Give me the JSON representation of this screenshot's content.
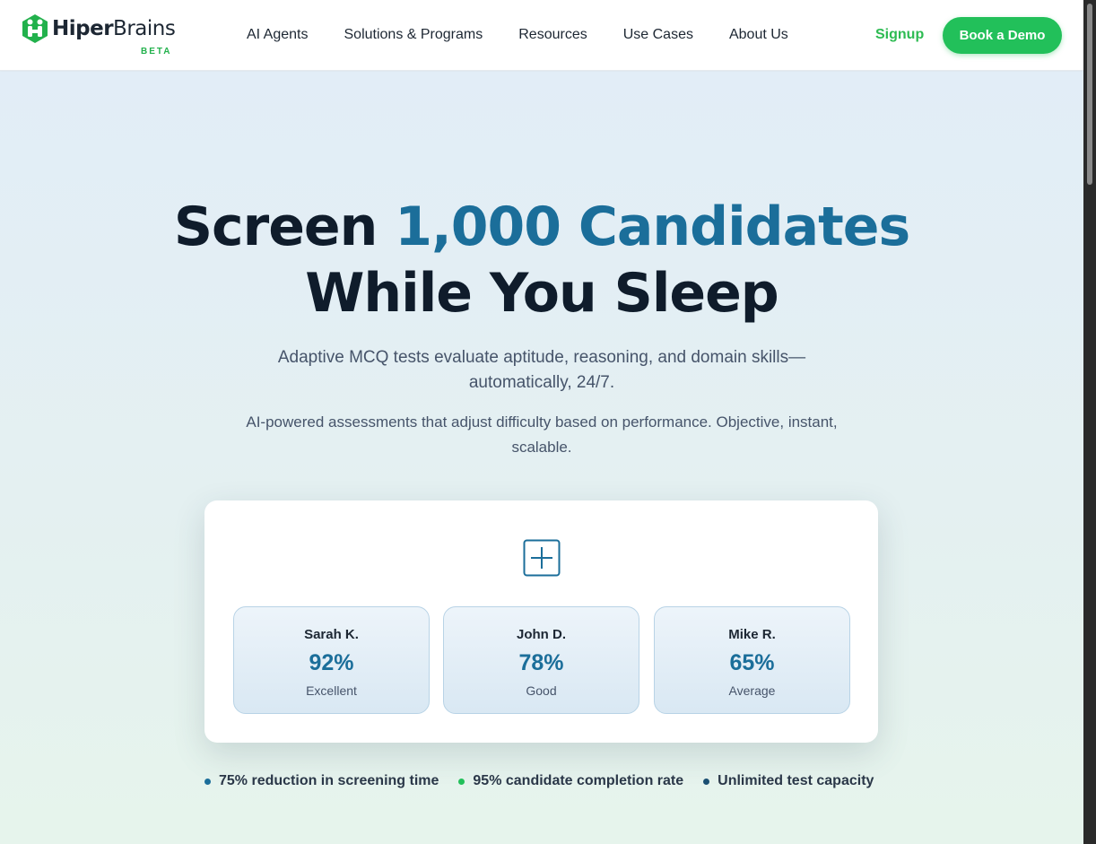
{
  "header": {
    "brand": {
      "part1": "Hiper",
      "part2": "Brains",
      "badge": "BETA",
      "icon": "brain-h-logo-icon"
    },
    "nav": [
      "AI Agents",
      "Solutions & Programs",
      "Resources",
      "Use Cases",
      "About Us"
    ],
    "signup_label": "Signup",
    "demo_label": "Book a Demo"
  },
  "hero": {
    "headline_line1_lead": "Screen ",
    "headline_line1_accent": "1,000 Candidates",
    "headline_line2": "While You Sleep",
    "subtitle": "Adaptive MCQ tests evaluate aptitude, reasoning, and domain skills—automatically, 24/7.",
    "description": "AI-powered assessments that adjust difficulty based on performance. Objective, instant, scalable."
  },
  "card": {
    "icon": "plus-square-icon",
    "candidates": [
      {
        "name": "Sarah K.",
        "score": "92%",
        "rating": "Excellent"
      },
      {
        "name": "John D.",
        "score": "78%",
        "rating": "Good"
      },
      {
        "name": "Mike R.",
        "score": "65%",
        "rating": "Average"
      }
    ]
  },
  "stats": [
    {
      "text": "75% reduction in screening time",
      "color": "#1b6e9a"
    },
    {
      "text": "95% candidate completion rate",
      "color": "#22c05a"
    },
    {
      "text": "Unlimited test capacity",
      "color": "#1a4f72"
    }
  ],
  "colors": {
    "accent": "#1b6e9a",
    "brand_green": "#22c05a",
    "dark_text": "#0f1c2b"
  }
}
